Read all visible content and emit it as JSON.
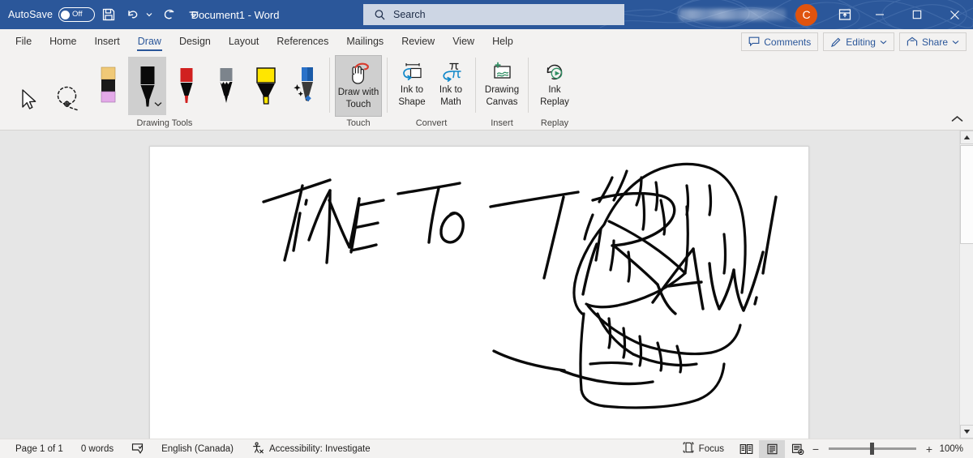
{
  "titlebar": {
    "autosave_label": "AutoSave",
    "autosave_state": "Off",
    "save_icon": "save-icon",
    "undo_icon": "undo-icon",
    "redo_icon": "redo-icon",
    "customize_qat_icon": "customize-quick-access-toolbar-icon",
    "document_title": "Document1  -  Word",
    "search_placeholder": "Search",
    "search_value": "",
    "search_icon": "search-icon",
    "account_initial": "C",
    "account_color": "#e0530d",
    "ribbon_display_icon": "ribbon-display-options-icon",
    "minimize_label": "—",
    "maximize_label": "☐",
    "close_label": "✕",
    "bar_color": "#2b579a"
  },
  "tabs": [
    {
      "label": "File",
      "active": false
    },
    {
      "label": "Home",
      "active": false
    },
    {
      "label": "Insert",
      "active": false
    },
    {
      "label": "Draw",
      "active": true
    },
    {
      "label": "Design",
      "active": false
    },
    {
      "label": "Layout",
      "active": false
    },
    {
      "label": "References",
      "active": false
    },
    {
      "label": "Mailings",
      "active": false
    },
    {
      "label": "Review",
      "active": false
    },
    {
      "label": "View",
      "active": false
    },
    {
      "label": "Help",
      "active": false
    }
  ],
  "tab_right": {
    "comments_label": "Comments",
    "comments_icon": "comment-icon",
    "editing_label": "Editing",
    "editing_icon": "pencil-icon",
    "editing_chevron": "chevron-down-icon",
    "share_label": "Share",
    "share_icon": "share-icon",
    "share_chevron": "chevron-down-icon",
    "accent_color": "#2b579a"
  },
  "ribbon": {
    "collapse_icon": "collapse-ribbon-chevron-icon",
    "groups": [
      {
        "name": "Drawing Tools",
        "label": "Drawing Tools",
        "tools": [
          {
            "name": "select-object-tool",
            "icon": "cursor-arrow-icon",
            "selected": false
          },
          {
            "name": "lasso-select-tool",
            "icon": "lasso-select-icon",
            "selected": false
          },
          {
            "name": "eraser-tool",
            "icon": "eraser-icon",
            "selected": false
          },
          {
            "name": "pen-black-tool",
            "icon": "pen-icon",
            "color": "#000000",
            "selected": true,
            "has_dropdown": true
          },
          {
            "name": "pen-red-tool",
            "icon": "pen-icon",
            "color": "#d1201f",
            "selected": false
          },
          {
            "name": "pencil-gray-tool",
            "icon": "pencil-icon",
            "color": "#767e86",
            "selected": false
          },
          {
            "name": "highlighter-yellow-tool",
            "icon": "highlighter-icon",
            "color": "#ffe600",
            "selected": false
          },
          {
            "name": "action-pen-tool",
            "icon": "action-pen-icon",
            "color": "#2a72c9",
            "selected": false
          }
        ]
      },
      {
        "name": "Touch",
        "label": "Touch",
        "buttons": [
          {
            "name": "draw-with-touch-button",
            "line1": "Draw with",
            "line2": "Touch",
            "icon": "hand-draw-icon",
            "active": true
          }
        ]
      },
      {
        "name": "Convert",
        "label": "Convert",
        "buttons": [
          {
            "name": "ink-to-shape-button",
            "line1": "Ink to",
            "line2": "Shape",
            "icon": "ink-to-shape-icon",
            "active": false
          },
          {
            "name": "ink-to-math-button",
            "line1": "Ink to",
            "line2": "Math",
            "icon": "ink-to-math-icon",
            "active": false
          }
        ]
      },
      {
        "name": "Insert",
        "label": "Insert",
        "buttons": [
          {
            "name": "drawing-canvas-button",
            "line1": "Drawing",
            "line2": "Canvas",
            "icon": "drawing-canvas-icon",
            "active": false
          }
        ]
      },
      {
        "name": "Replay",
        "label": "Replay",
        "buttons": [
          {
            "name": "ink-replay-button",
            "line1": "Ink",
            "line2": "Replay",
            "icon": "ink-replay-icon",
            "active": false
          }
        ]
      }
    ]
  },
  "document": {
    "ink_text": "TIME TO DRAW!",
    "ink_drawing": "skull-sketch",
    "ink_color": "#000000",
    "page_background": "#ffffff",
    "canvas_background": "#e6e6e6"
  },
  "scrollbar": {
    "up_arrow_icon": "scroll-up-arrow-icon",
    "down_arrow_icon": "scroll-down-arrow-icon",
    "thumb_name": "vertical-scroll-thumb"
  },
  "statusbar": {
    "page_count": "Page 1 of 1",
    "word_count": "0 words",
    "proofing_icon": "proofing-errors-icon",
    "language": "English (Canada)",
    "accessibility_icon": "accessibility-icon",
    "accessibility": "Accessibility: Investigate",
    "focus_label": "Focus",
    "focus_icon": "focus-mode-icon",
    "view_read_icon": "read-mode-icon",
    "view_print_icon": "print-layout-icon",
    "view_web_icon": "web-layout-icon",
    "zoom_out": "−",
    "zoom_in": "+",
    "zoom_level": "100%"
  }
}
